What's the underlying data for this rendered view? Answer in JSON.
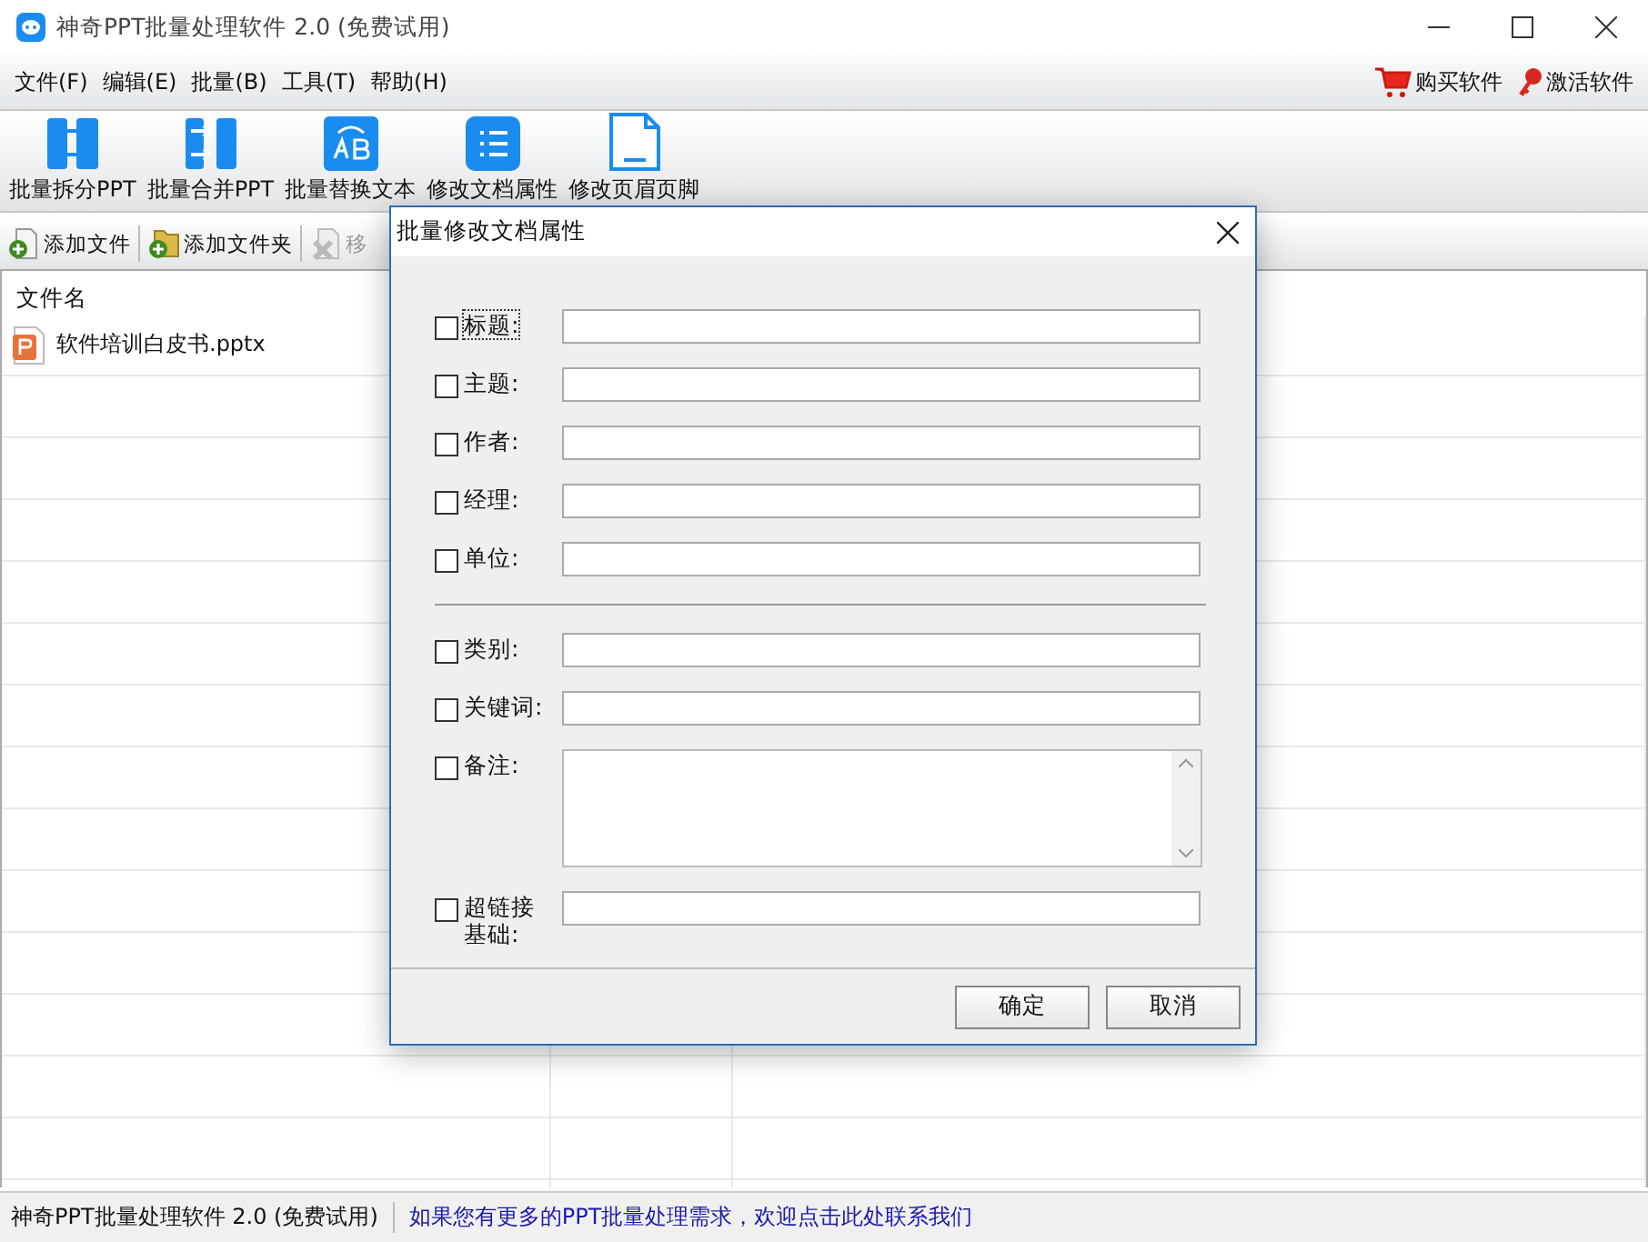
{
  "window": {
    "title": "神奇PPT批量处理软件 2.0 (免费试用)"
  },
  "menu": [
    {
      "label": "文件(F)"
    },
    {
      "label": "编辑(E)"
    },
    {
      "label": "批量(B)"
    },
    {
      "label": "工具(T)"
    },
    {
      "label": "帮助(H)"
    }
  ],
  "menu_right": [
    {
      "kind": "cart",
      "label": "购买软件"
    },
    {
      "kind": "key",
      "label": "激活软件"
    }
  ],
  "toolbar": [
    {
      "kind": "split",
      "label": "批量拆分PPT"
    },
    {
      "kind": "merge",
      "label": "批量合并PPT"
    },
    {
      "kind": "replace",
      "label": "批量替换文本"
    },
    {
      "kind": "props",
      "label": "修改文档属性"
    },
    {
      "kind": "page",
      "label": "修改页眉页脚"
    }
  ],
  "file_toolbar": [
    {
      "kind": "add-file",
      "label": "添加文件",
      "disabled": false
    },
    {
      "kind": "add-folder",
      "label": "添加文件夹",
      "disabled": false
    },
    {
      "kind": "remove",
      "label": "移",
      "disabled": true
    }
  ],
  "file_list": {
    "columns": [
      "文件名"
    ],
    "rows": [
      {
        "name": "软件培训白皮书.pptx"
      }
    ]
  },
  "dialog": {
    "title": "批量修改文档属性",
    "fields": [
      {
        "kind": "text",
        "label": "标题:",
        "checked": false,
        "focused": true
      },
      {
        "kind": "text",
        "label": "主题:",
        "checked": false,
        "focused": false
      },
      {
        "kind": "text",
        "label": "作者:",
        "checked": false,
        "focused": false
      },
      {
        "kind": "text",
        "label": "经理:",
        "checked": false,
        "focused": false
      },
      {
        "kind": "text",
        "label": "单位:",
        "checked": false,
        "focused": false
      },
      {
        "kind": "separator"
      },
      {
        "kind": "text",
        "label": "类别:",
        "checked": false,
        "focused": false
      },
      {
        "kind": "text",
        "label": "关键词:",
        "checked": false,
        "focused": false
      },
      {
        "kind": "multiline",
        "label": "备注:",
        "checked": false,
        "focused": false
      },
      {
        "kind": "text",
        "label": "超链接基础:",
        "checked": false,
        "focused": false
      }
    ],
    "buttons": [
      "确定",
      "取消"
    ]
  },
  "status_bar": {
    "app": "神奇PPT批量处理软件 2.0 (免费试用)",
    "link": "如果您有更多的PPT批量处理需求，欢迎点击此处联系我们"
  }
}
